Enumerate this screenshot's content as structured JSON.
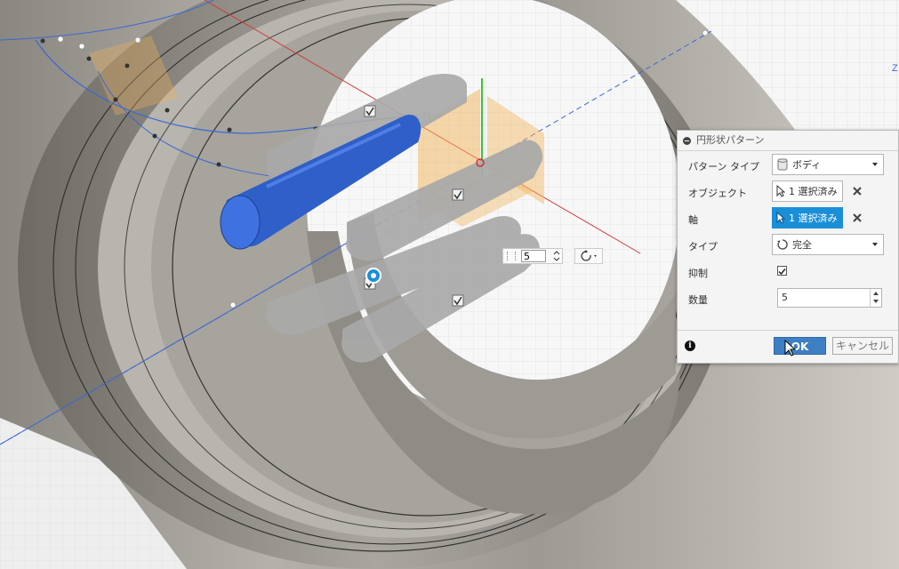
{
  "dialog": {
    "title": "円形状パターン",
    "rows": {
      "pattern_type": {
        "label": "パターン タイプ",
        "value": "ボディ"
      },
      "objects": {
        "label": "オブジェクト",
        "value": "1 選択済み"
      },
      "axis": {
        "label": "軸",
        "value": "1 選択済み"
      },
      "type": {
        "label": "タイプ",
        "value": "完全"
      },
      "suppress": {
        "label": "抑制",
        "checked": true
      },
      "quantity": {
        "label": "数量",
        "value": "5"
      }
    },
    "ok_label": "OK",
    "cancel_label": "キャンセル"
  },
  "canvas": {
    "quantity_input": "5",
    "axis_label": "Z"
  },
  "colors": {
    "accent": "#1a8fd7",
    "ok_button": "#3d7fc2",
    "selected_body": "#2f5fc8",
    "axis_red": "#d23a3a",
    "axis_green": "#3ac43a",
    "axis_blue": "#3a6ad2",
    "plane_orange": "#f2b35a"
  }
}
